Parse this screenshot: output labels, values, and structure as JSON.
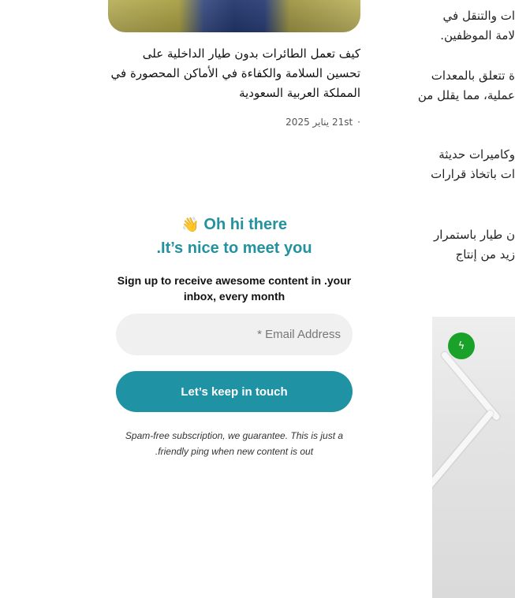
{
  "post": {
    "title": "كيف تعمل الطائرات بدون طيار الداخلية على تحسين السلامة والكفاءة في الأماكن المحصورة في المملكة العربية السعودية",
    "date": "21st يناير 2025",
    "separator": "·"
  },
  "subscribe": {
    "greeting_line1": "Oh hi there",
    "greeting_emoji": "👋",
    "greeting_line2": ".It’s nice to meet you",
    "description": "Sign up to receive awesome content in .your inbox, every month",
    "email_placeholder": "* Email Address",
    "button_label": "Let’s keep in touch",
    "spam_note": "Spam-free subscription, we guarantee. This is just a .friendly ping when new content is out"
  },
  "article": {
    "paragraphs": [
      [
        "ات والتنقل في",
        "لامة الموظفين."
      ],
      [
        "ة تتعلق بالمعدات",
        "عملية، مما يقلل من"
      ],
      [
        "وكاميرات حديثة",
        "ات باتخاذ قرارات"
      ],
      [
        "ن طيار باستمرار",
        "زيد من إنتاج"
      ]
    ]
  },
  "image_badge": {
    "icon": "lightning-bolt-icon",
    "glyph": "ϟ",
    "color": "#1aa12a"
  },
  "colors": {
    "accent": "#23929e",
    "button": "#1f92a3"
  }
}
